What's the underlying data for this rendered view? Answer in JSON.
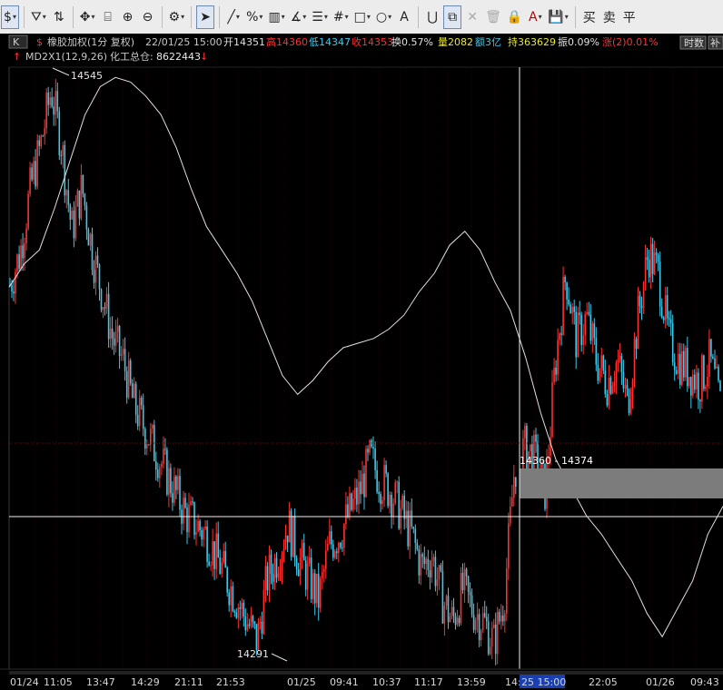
{
  "toolbar": {
    "items": [
      {
        "name": "currency-selector-button",
        "icon": "$",
        "type": "btn",
        "drop": true,
        "pressed": true
      },
      {
        "name": "sep"
      },
      {
        "name": "filter-button",
        "icon": "⛛",
        "type": "btn",
        "drop": true
      },
      {
        "name": "period-switch-button",
        "icon": "⇅",
        "type": "btn",
        "bordered": true
      },
      {
        "name": "sep"
      },
      {
        "name": "pan-tool-button",
        "icon": "✥",
        "type": "btn",
        "drop": true
      },
      {
        "name": "column-width-button",
        "icon": "⌸",
        "type": "btn"
      },
      {
        "name": "zoom-in-button",
        "icon": "⊕",
        "type": "btn"
      },
      {
        "name": "zoom-out-button",
        "icon": "⊖",
        "type": "btn"
      },
      {
        "name": "sep"
      },
      {
        "name": "settings-button",
        "icon": "⚙",
        "type": "btn",
        "drop": true
      },
      {
        "name": "sep"
      },
      {
        "name": "cursor-tool-button",
        "icon": "➤",
        "type": "btn",
        "pressed": true
      },
      {
        "name": "sep"
      },
      {
        "name": "line-tool-button",
        "icon": "╱",
        "type": "btn",
        "drop": true
      },
      {
        "name": "fibonacci-tool-button",
        "icon": "%",
        "type": "btn",
        "drop": true
      },
      {
        "name": "channel-tool-button",
        "icon": "▥",
        "type": "btn",
        "drop": true
      },
      {
        "name": "angle-tool-button",
        "icon": "∡",
        "type": "btn",
        "drop": true
      },
      {
        "name": "level-tool-button",
        "icon": "☰",
        "type": "btn",
        "drop": true
      },
      {
        "name": "grid-tool-button",
        "icon": "#",
        "type": "btn",
        "drop": true
      },
      {
        "name": "rectangle-tool-button",
        "icon": "□",
        "type": "btn",
        "drop": true
      },
      {
        "name": "ellipse-tool-button",
        "icon": "○",
        "type": "btn",
        "drop": true
      },
      {
        "name": "text-tool-button",
        "icon": "A",
        "type": "btn"
      },
      {
        "name": "sep"
      },
      {
        "name": "magnet-button",
        "icon": "⋃",
        "type": "btn"
      },
      {
        "name": "copy-drawing-button",
        "icon": "⧉",
        "type": "btn",
        "pressed": true
      },
      {
        "name": "delete-drawing-button",
        "icon": "✕",
        "type": "btn",
        "disabled": true
      },
      {
        "name": "trash-button",
        "icon": "🗑",
        "type": "btn",
        "disabled": true
      },
      {
        "name": "lock-button",
        "icon": "🔒",
        "type": "btn"
      },
      {
        "name": "text-color-button",
        "icon": "A",
        "type": "btn",
        "drop": true,
        "color": "#c00000"
      },
      {
        "name": "save-template-button",
        "icon": "💾",
        "type": "btn",
        "drop": true
      },
      {
        "name": "sep"
      },
      {
        "name": "buy-button",
        "icon": "买",
        "type": "btn"
      },
      {
        "name": "sell-button",
        "icon": "卖",
        "type": "btn"
      },
      {
        "name": "close-position-button",
        "icon": "平",
        "type": "btn"
      }
    ]
  },
  "header": {
    "period_tab": "K",
    "marker_icon": "$",
    "symbol": "橡胶加权(1分 复权)",
    "datetime": "22/01/25 15:00",
    "open_label": "开",
    "open_value": "14351",
    "high_label": "高",
    "high_value": "14360",
    "low_label": "低",
    "low_value": "14347",
    "close_label": "收",
    "close_value": "14353",
    "turnover_label": "换",
    "turnover_value": "0.57%",
    "volume_label": "量",
    "volume_value": "2082",
    "amount_label": "额",
    "amount_value": "3亿",
    "position_label": "持",
    "position_value": "363629",
    "amplitude_label": "振",
    "amplitude_value": "0.09%",
    "change_label": "涨",
    "change_value": "(2)0.01%",
    "time_share_button": "时数",
    "indicator_name": "MD2X1(12,9,26)",
    "indicator_sub": "化工总仓:",
    "indicator_value": "8622443",
    "indicator_arrow": "↓",
    "side_button": "补"
  },
  "chart_data": {
    "type": "candlestick",
    "x_ticks": [
      "01/24",
      "11:05",
      "13:47",
      "14:29",
      "21:11",
      "21:53",
      "01/25",
      "09:41",
      "10:37",
      "11:17",
      "13:59",
      "14:42",
      "22:05",
      "01/26",
      "09:43"
    ],
    "crosshair_time": "22/01/25 15:00",
    "crosshair_time_label": "25 15:00",
    "max_label": "14545",
    "min_label": "14291",
    "range_label": "14360 - 14374",
    "close_trend": [
      14455,
      14470,
      14500,
      14520,
      14545,
      14520,
      14480,
      14500,
      14470,
      14450,
      14430,
      14420,
      14400,
      14390,
      14380,
      14370,
      14360,
      14350,
      14345,
      14340,
      14330,
      14320,
      14310,
      14300,
      14291,
      14320,
      14330,
      14345,
      14330,
      14320,
      14310,
      14335,
      14340,
      14350,
      14360,
      14375,
      14365,
      14360,
      14350,
      14340,
      14325,
      14330,
      14310,
      14300,
      14315,
      14305,
      14300,
      14290,
      14310,
      14370,
      14380,
      14375,
      14360,
      14420,
      14460,
      14430,
      14440,
      14420,
      14410,
      14420,
      14400,
      14440,
      14470,
      14460,
      14430,
      14420,
      14415,
      14410,
      14420,
      14400
    ],
    "indicator_trend": [
      0.25,
      0.3,
      0.33,
      0.42,
      0.52,
      0.62,
      0.68,
      0.7,
      0.69,
      0.66,
      0.62,
      0.55,
      0.46,
      0.38,
      0.33,
      0.28,
      0.22,
      0.14,
      0.06,
      0.02,
      0.05,
      0.09,
      0.12,
      0.13,
      0.14,
      0.16,
      0.19,
      0.24,
      0.28,
      0.34,
      0.37,
      0.33,
      0.26,
      0.2,
      0.1,
      -0.02,
      -0.12,
      -0.18,
      -0.24,
      -0.28,
      -0.33,
      -0.38,
      -0.45,
      -0.5,
      -0.44,
      -0.38,
      -0.28,
      -0.22
    ],
    "colors": {
      "up": "#ff3030",
      "down": "#40c8e8",
      "indicator": "#e8e8e8",
      "crosshair": "#ffffff",
      "range_box": "#808080",
      "grid": "#8b0000"
    }
  }
}
